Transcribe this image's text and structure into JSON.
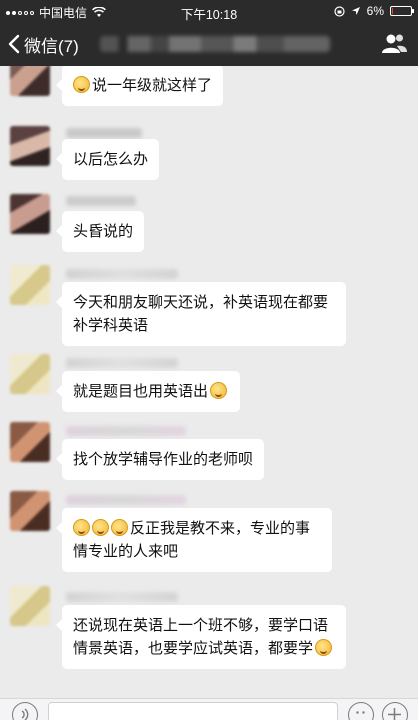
{
  "status_bar": {
    "carrier": "中国电信",
    "time": "下午10:18",
    "battery": "6%",
    "battery_level": 0.06
  },
  "nav": {
    "back_label": "微信(7)",
    "icons": [
      "chevron-left-icon",
      "group-profile-icon"
    ]
  },
  "messages": [
    {
      "text": "说一年级就这样了",
      "leading_emoji": 1
    },
    {
      "text": "以后怎么办",
      "leading_emoji": 0
    },
    {
      "text": "头昏说的",
      "leading_emoji": 0
    },
    {
      "text": "今天和朋友聊天还说，补英语现在都要补学科英语",
      "leading_emoji": 0
    },
    {
      "text": "就是题目也用英语出",
      "trailing_emoji": 1
    },
    {
      "text": "找个放学辅导作业的老师呗",
      "leading_emoji": 0
    },
    {
      "text": "反正我是教不来，专业的事情专业的人来吧",
      "leading_emoji": 3
    },
    {
      "text": "还说现在英语上一个班不够，要学口语情景英语，也要学应试英语，都要学",
      "trailing_emoji": 1
    }
  ],
  "colors": {
    "bar_bg": "#2b2b2b",
    "chat_bg": "#ebebeb",
    "bubble_bg": "#ffffff",
    "battery_low": "#ff3b30"
  }
}
